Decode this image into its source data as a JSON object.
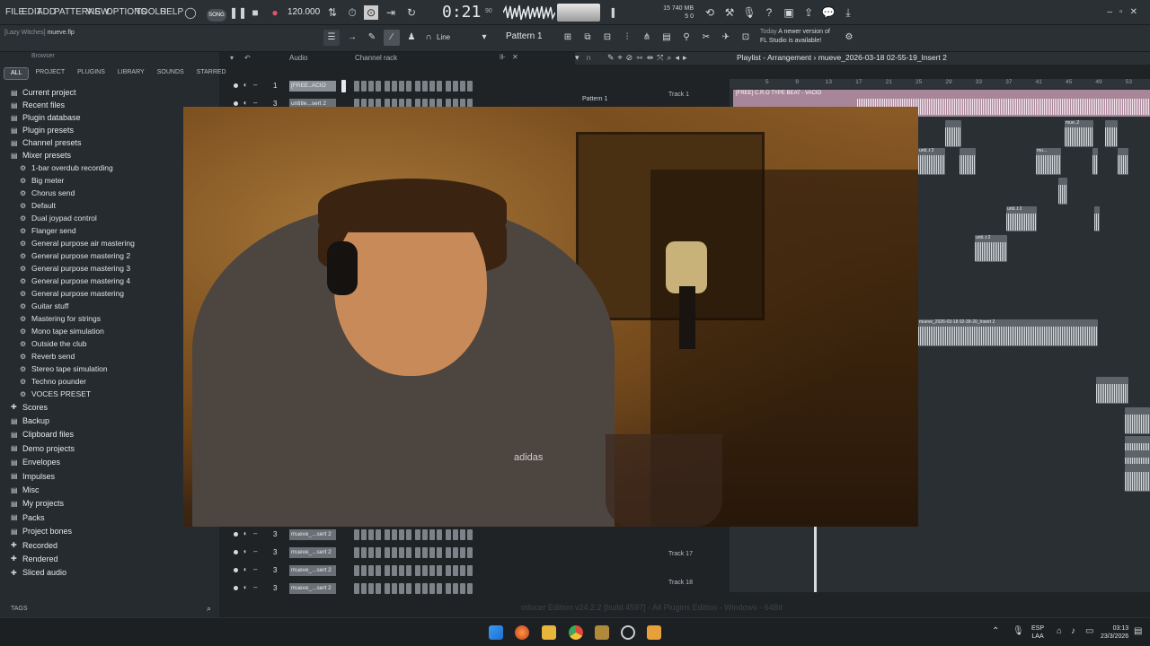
{
  "menu": [
    "FILE",
    "EDIT",
    "ADD",
    "PATTERNS",
    "VIEW",
    "OPTIONS",
    "TOOLS",
    "HELP"
  ],
  "transport": {
    "tempo": "120.000",
    "time": "0:21",
    "time_sub": "90",
    "song_mode": "SONG"
  },
  "cpu": {
    "memory": "740 MB",
    "cpu_line": "15",
    "voices": "5",
    "zero": "0"
  },
  "project_hint": {
    "prefix": "[Lazy Witches]",
    "file": "mueve.flp"
  },
  "pattern_selector": "Pattern 1",
  "draw_mode": "Line",
  "news": {
    "date": "Today",
    "line1": "A newer version of",
    "line2": "FL Studio is available!"
  },
  "browser": {
    "title": "Browser",
    "tabs": [
      "ALL",
      "PROJECT",
      "PLUGINS",
      "LIBRARY",
      "SOUNDS",
      "STARRED"
    ],
    "top_items": [
      {
        "label": "Current project",
        "icon": "folder-open-icon"
      },
      {
        "label": "Recent files",
        "icon": "folder-open-icon"
      },
      {
        "label": "Plugin database",
        "icon": "folder-open-icon"
      },
      {
        "label": "Plugin presets",
        "icon": "folder-open-icon"
      },
      {
        "label": "Channel presets",
        "icon": "folder-open-icon"
      },
      {
        "label": "Mixer presets",
        "icon": "folder-open-icon"
      }
    ],
    "mixer_presets": [
      "1-bar overdub recording",
      "Big meter",
      "Chorus send",
      "Default",
      "Dual joypad control",
      "Flanger send",
      "General purpose air mastering",
      "General purpose mastering 2",
      "General purpose mastering 3",
      "General purpose mastering 4",
      "General purpose mastering",
      "Guitar stuff",
      "Mastering for strings",
      "Mono tape simulation",
      "Outside the club",
      "Reverb send",
      "Stereo tape simulation",
      "Techno pounder",
      "VOCES PRESET"
    ],
    "bottom_items": [
      {
        "label": "Scores",
        "icon": "plus-folder-icon"
      },
      {
        "label": "Backup",
        "icon": "folder-open-icon"
      },
      {
        "label": "Clipboard files",
        "icon": "folder-open-icon"
      },
      {
        "label": "Demo projects",
        "icon": "folder-open-icon"
      },
      {
        "label": "Envelopes",
        "icon": "folder-open-icon"
      },
      {
        "label": "Impulses",
        "icon": "folder-open-icon"
      },
      {
        "label": "Misc",
        "icon": "folder-open-icon"
      },
      {
        "label": "My projects",
        "icon": "folder-open-icon"
      },
      {
        "label": "Packs",
        "icon": "folder-open-icon"
      },
      {
        "label": "Project bones",
        "icon": "folder-open-icon"
      },
      {
        "label": "Recorded",
        "icon": "plus-folder-icon"
      },
      {
        "label": "Rendered",
        "icon": "plus-folder-icon"
      },
      {
        "label": "Sliced audio",
        "icon": "plus-folder-icon"
      }
    ],
    "tags_label": "TAGS"
  },
  "channel_rack": {
    "filter": "Audio",
    "title": "Channel rack",
    "channels_top": [
      {
        "num": "1",
        "name": "[FREE..ACIO"
      },
      {
        "num": "3",
        "name": "untitle...sert 2"
      }
    ],
    "channels_bottom": [
      {
        "num": "3",
        "name": "mueve_...sert 2"
      },
      {
        "num": "3",
        "name": "mueve_...sert 2"
      },
      {
        "num": "3",
        "name": "mueve_...sert 2"
      },
      {
        "num": "3",
        "name": "mueve_...sert 2"
      }
    ]
  },
  "playlist": {
    "title": "Playlist - Arrangement",
    "arrangement": "mueve_2026-03-18 02-55-19_Insert 2",
    "pattern_label": "Pattern 1",
    "ruler": [
      "5",
      "9",
      "13",
      "17",
      "21",
      "25",
      "29",
      "33",
      "37",
      "41",
      "45",
      "49",
      "53"
    ],
    "tracks": [
      {
        "label": "Track 1"
      },
      {
        "label": "Track 17"
      },
      {
        "label": "Track 18"
      }
    ],
    "beat_clip": "[FREE] C.R.O TYPE BEAT - VACIO",
    "clip_labels": [
      "muе..2",
      "unti..t 2",
      "mu...",
      "unti..t 2",
      "unti..t 2",
      "mueve_2026-03-18 02-39-20_Insert 2"
    ]
  },
  "webcam": {
    "logo": "adidas"
  },
  "status_strip": "oducer Edition v24.2.2 [build 4597] - All Plugins Edition - Windows - 64Bit",
  "taskbar": {
    "lang_top": "ESP",
    "lang_bottom": "LAA",
    "time": "03:13",
    "date": "23/3/2026"
  },
  "colors": {
    "accent": "#a88699",
    "panel": "#262b2f",
    "toolbar": "#2b3034"
  }
}
